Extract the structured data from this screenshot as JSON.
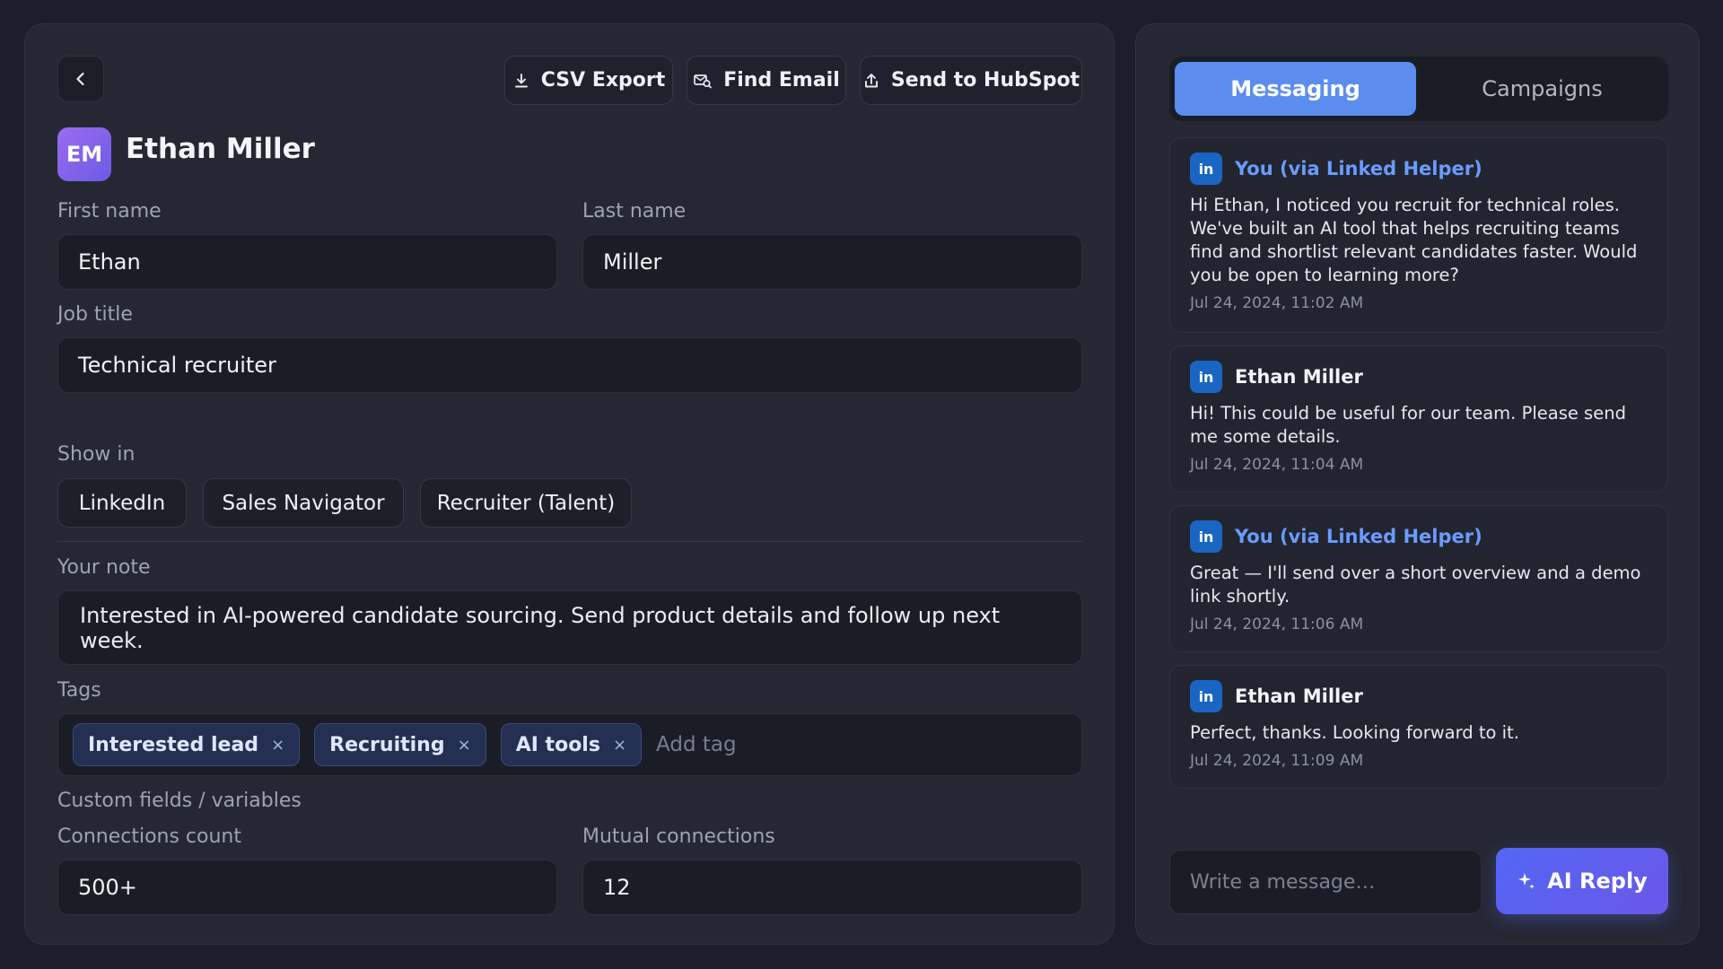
{
  "toolbar": {
    "csv_export": "CSV Export",
    "find_email": "Find Email",
    "send_hubspot": "Send to HubSpot"
  },
  "profile": {
    "initials": "EM",
    "full_name": "Ethan Miller",
    "first_name_label": "First name",
    "first_name": "Ethan",
    "last_name_label": "Last name",
    "last_name": "Miller",
    "job_title_label": "Job title",
    "job_title": "Technical recruiter"
  },
  "show_in": {
    "label": "Show in",
    "options": [
      "LinkedIn",
      "Sales Navigator",
      "Recruiter (Talent)"
    ]
  },
  "note": {
    "label": "Your note",
    "text": "Interested in AI-powered candidate sourcing. Send product details and follow up next week."
  },
  "tags": {
    "label": "Tags",
    "items": [
      "Interested lead",
      "Recruiting",
      "AI tools"
    ],
    "remove_glyph": "×",
    "placeholder": "Add tag"
  },
  "custom": {
    "label": "Custom fields / variables",
    "connections_label": "Connections count",
    "connections_value": "500+",
    "mutual_label": "Mutual connections",
    "mutual_value": "12"
  },
  "tabs": {
    "messaging": "Messaging",
    "campaigns": "Campaigns"
  },
  "messages": [
    {
      "sender": "You (via Linked Helper)",
      "icon": "in",
      "body": "Hi Ethan, I noticed you recruit for technical roles. We've built an AI tool that helps recruiting teams find and shortlist relevant candidates faster. Would you be open to learning more?",
      "time": "Jul 24, 2024, 11:02 AM"
    },
    {
      "sender": "Ethan Miller",
      "icon": "in",
      "body": "Hi! This could be useful for our team. Please send me some details.",
      "time": "Jul 24, 2024, 11:04 AM"
    },
    {
      "sender": "You (via Linked Helper)",
      "icon": "in",
      "body": "Great — I'll send over a short overview and a demo link shortly.",
      "time": "Jul 24, 2024, 11:06 AM"
    },
    {
      "sender": "Ethan Miller",
      "icon": "in",
      "body": "Perfect, thanks. Looking forward to it.",
      "time": "Jul 24, 2024, 11:09 AM"
    }
  ],
  "compose": {
    "placeholder": "Write a message…",
    "ai_reply": "AI Reply"
  },
  "colors": {
    "accent": "#5b8def",
    "linkedin": "#1966c2",
    "you_sender": "#6b9bff"
  }
}
